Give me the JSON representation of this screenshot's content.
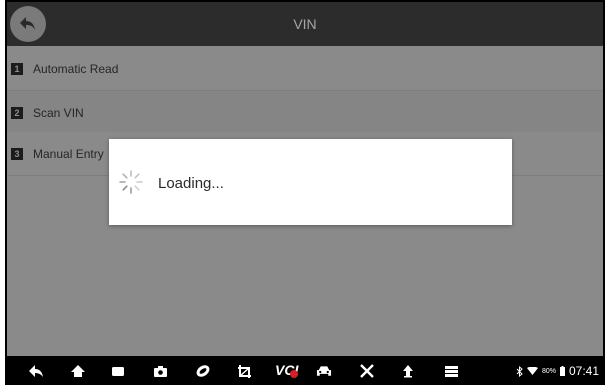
{
  "header": {
    "title": "VIN",
    "back_icon": "back-arrow-icon"
  },
  "menu": {
    "items": [
      {
        "number": "1",
        "label": "Automatic Read"
      },
      {
        "number": "2",
        "label": "Scan VIN"
      },
      {
        "number": "3",
        "label": "Manual Entry"
      }
    ]
  },
  "dialog": {
    "message": "Loading...",
    "spinner_icon": "loading-spinner-icon"
  },
  "navbar": {
    "icons": [
      "back-icon",
      "home-icon",
      "recent-apps-icon",
      "screenshot-icon",
      "browser-icon",
      "crop-icon",
      "vci-icon",
      "car-icon",
      "tools-icon",
      "upload-icon",
      "menu-icon"
    ],
    "vci_label": "VCI",
    "battery": "80%",
    "time": "07:41"
  },
  "colors": {
    "overlay_gray": "#8a8a8a",
    "header_dark": "#2c2c2c",
    "vci_status_red": "#d82020"
  }
}
